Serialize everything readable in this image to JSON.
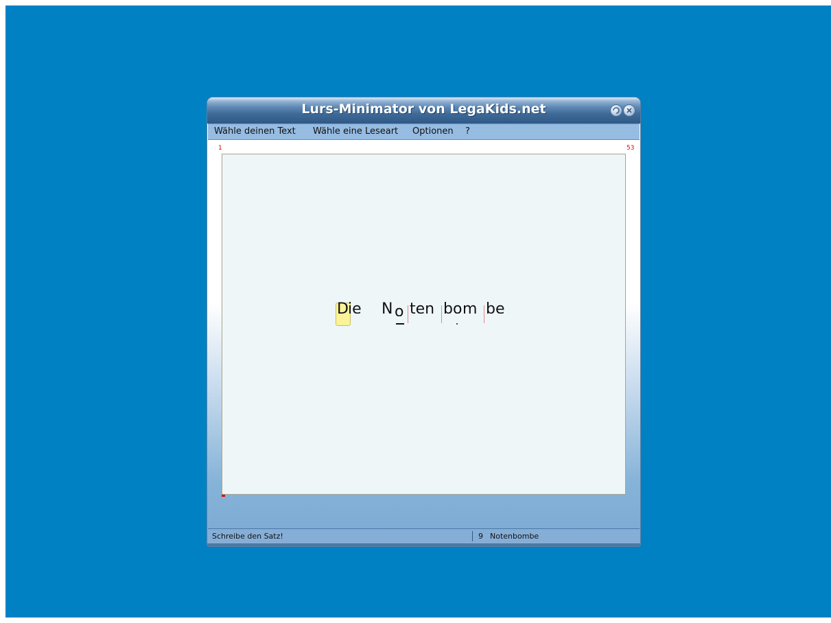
{
  "window": {
    "title": "Lurs-Minimator von LegaKids.net"
  },
  "menu": {
    "items": [
      "Wähle deinen Text",
      "Wähle eine Leseart",
      "Optionen",
      "?"
    ]
  },
  "counter": {
    "start": "1",
    "end": "53"
  },
  "sentence": {
    "glyphs": [
      "D",
      "ie",
      "N",
      "o",
      "ten",
      "b",
      "o",
      "m",
      "be"
    ]
  },
  "status": {
    "message": "Schreibe den Satz!",
    "word_number": "9",
    "word": "Notenbombe"
  },
  "colors": {
    "desktop": "#0081c4",
    "counter": "#e00000",
    "cursor_highlight": "#fbf39a"
  }
}
